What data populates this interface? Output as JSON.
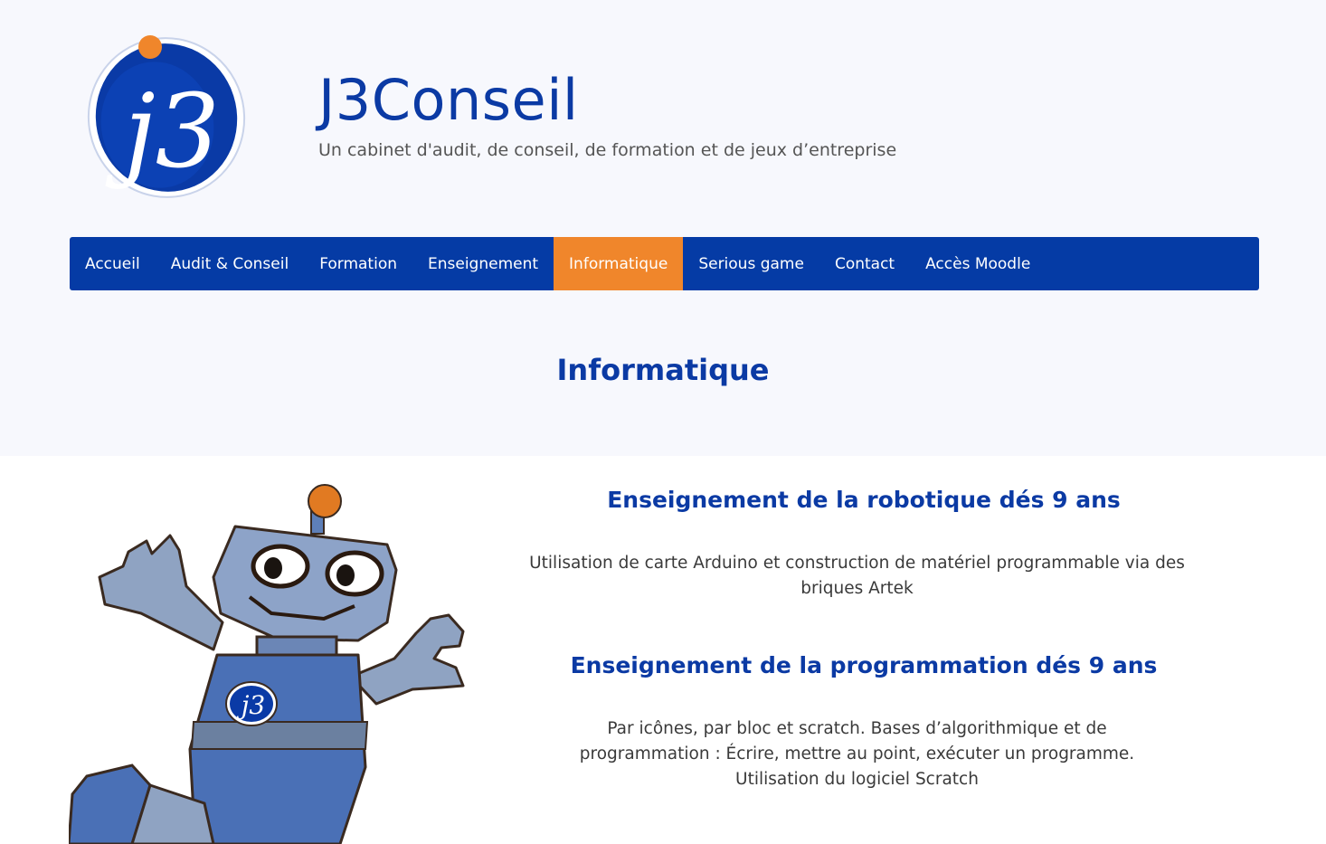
{
  "site": {
    "title": "J3Conseil",
    "tagline": "Un cabinet d'audit, de conseil, de formation et de jeux d’entreprise",
    "logo_text": "j3"
  },
  "nav": {
    "items": [
      {
        "label": "Accueil",
        "active": false
      },
      {
        "label": "Audit & Conseil",
        "active": false
      },
      {
        "label": "Formation",
        "active": false
      },
      {
        "label": "Enseignement",
        "active": false
      },
      {
        "label": "Informatique",
        "active": true
      },
      {
        "label": "Serious game",
        "active": false
      },
      {
        "label": "Contact",
        "active": false
      },
      {
        "label": "Accès Moodle",
        "active": false
      }
    ]
  },
  "page": {
    "title": "Informatique"
  },
  "sections": [
    {
      "heading": "Enseignement de la robotique dés 9 ans",
      "text": "Utilisation de carte Arduino et construction de matériel programmable via des briques Artek"
    },
    {
      "heading": "Enseignement de la programmation dés 9 ans",
      "text": "Par icônes, par bloc et scratch. Bases d’algorithmique et de programmation : Écrire, mettre au point, exécuter un programme. Utilisation du logiciel Scratch"
    }
  ],
  "robot": {
    "badge_text": "j3"
  },
  "colors": {
    "brand_blue": "#053ba5",
    "accent_orange": "#f0862b",
    "band_background": "#f7f8fd"
  }
}
